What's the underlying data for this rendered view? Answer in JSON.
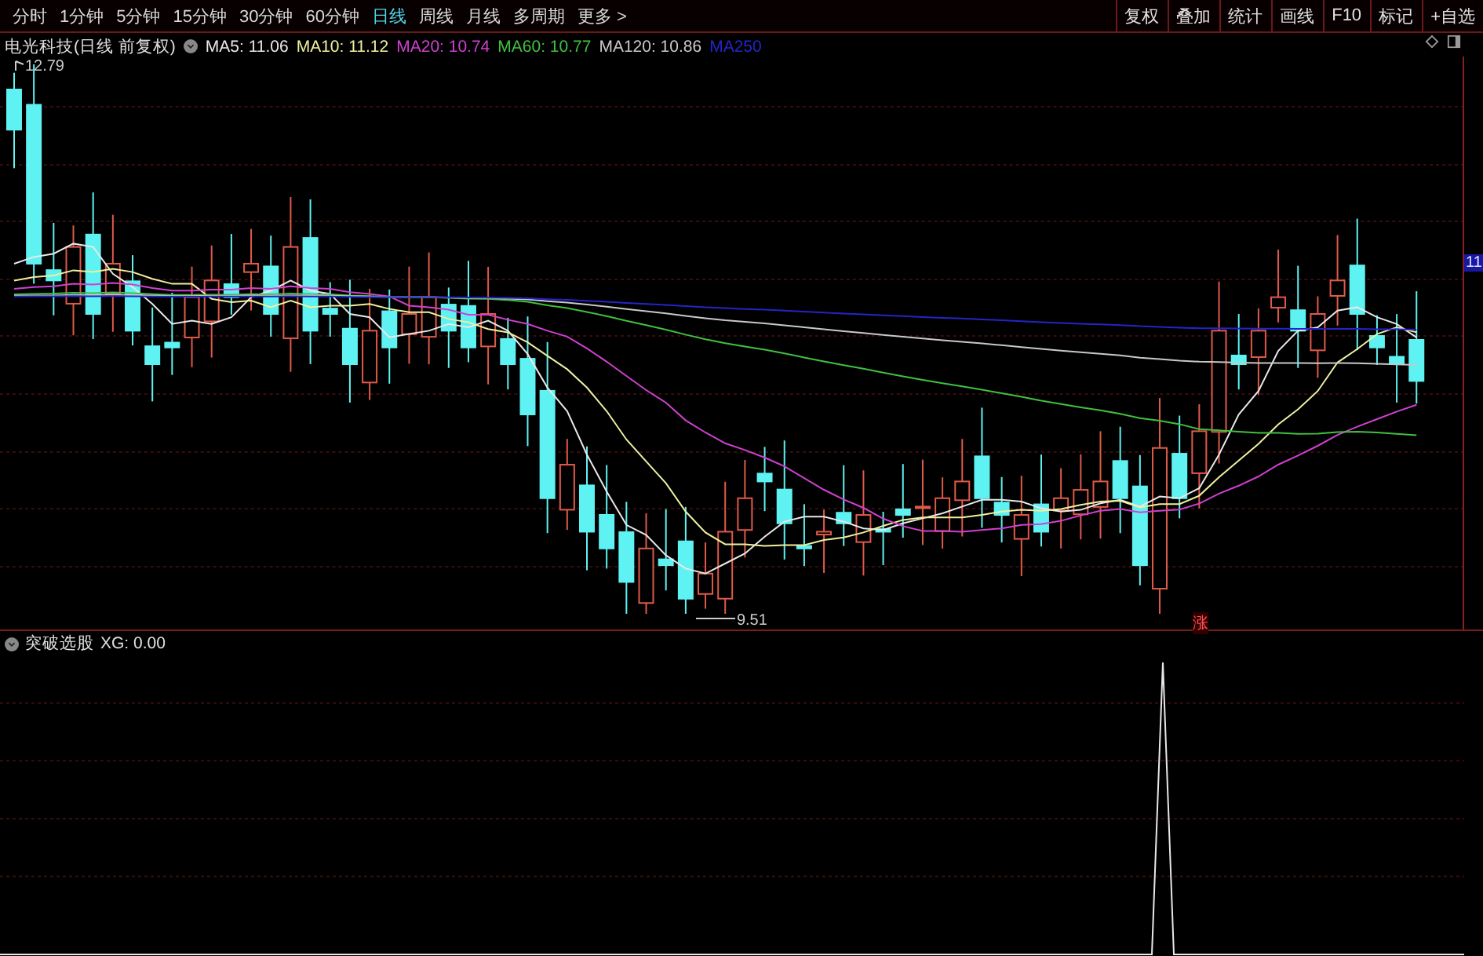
{
  "toolbar": {
    "periods": [
      {
        "label": "分时",
        "selected": false
      },
      {
        "label": "1分钟",
        "selected": false
      },
      {
        "label": "5分钟",
        "selected": false
      },
      {
        "label": "15分钟",
        "selected": false
      },
      {
        "label": "30分钟",
        "selected": false
      },
      {
        "label": "60分钟",
        "selected": false
      },
      {
        "label": "日线",
        "selected": true
      },
      {
        "label": "周线",
        "selected": false
      },
      {
        "label": "月线",
        "selected": false
      },
      {
        "label": "多周期",
        "selected": false
      }
    ],
    "more": "更多 >",
    "actions": [
      "复权",
      "叠加",
      "统计",
      "画线",
      "F10",
      "标记",
      "+自选"
    ]
  },
  "legend": {
    "title": "电光科技(日线 前复权)",
    "ma": [
      {
        "label": "MA5: 11.06",
        "color": "#e8e8e8"
      },
      {
        "label": "MA10: 11.12",
        "color": "#f0f0a0"
      },
      {
        "label": "MA20: 10.74",
        "color": "#d040d0"
      },
      {
        "label": "MA60: 10.77",
        "color": "#40c040"
      },
      {
        "label": "MA120: 10.86",
        "color": "#c8c8c8"
      },
      {
        "label": "MA250",
        "color": "#2424c8"
      }
    ]
  },
  "price_labels": {
    "high": "12.79",
    "low": "9.51"
  },
  "axis_badge": "11",
  "marker": "涨",
  "indicator": {
    "title": "突破选股",
    "reading": "XG: 0.00"
  }
}
